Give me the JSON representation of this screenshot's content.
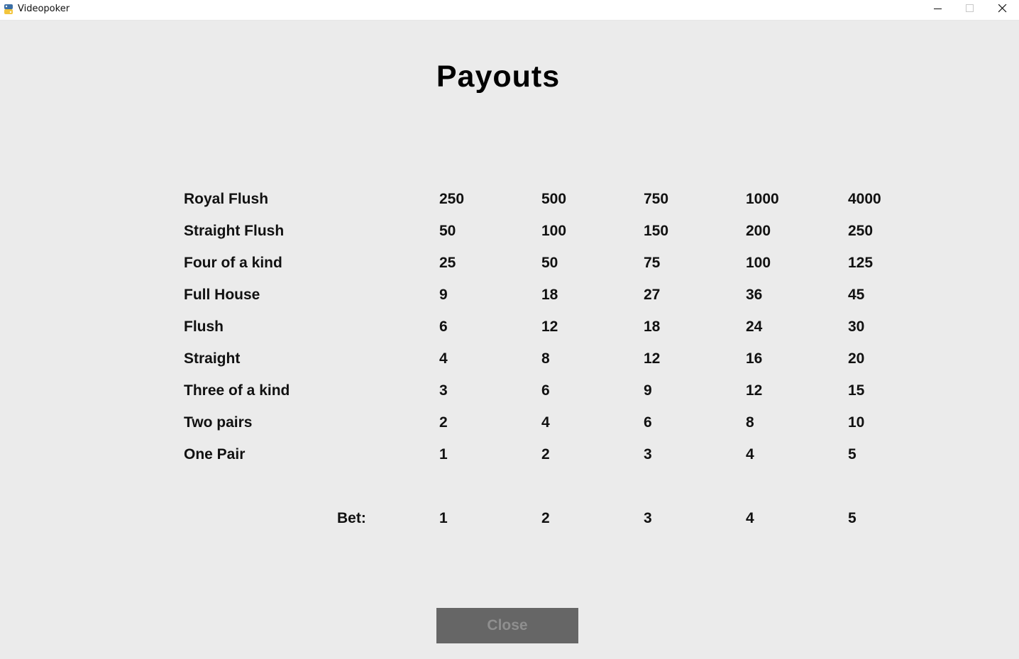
{
  "window": {
    "title": "Videopoker",
    "icon": "python-icon"
  },
  "page": {
    "title": "Payouts"
  },
  "paytable": {
    "rows": [
      {
        "label": "Royal Flush",
        "values": [
          "250",
          "500",
          "750",
          "1000",
          "4000"
        ]
      },
      {
        "label": "Straight Flush",
        "values": [
          "50",
          "100",
          "150",
          "200",
          "250"
        ]
      },
      {
        "label": "Four of a kind",
        "values": [
          "25",
          "50",
          "75",
          "100",
          "125"
        ]
      },
      {
        "label": "Full House",
        "values": [
          "9",
          "18",
          "27",
          "36",
          "45"
        ]
      },
      {
        "label": "Flush",
        "values": [
          "6",
          "12",
          "18",
          "24",
          "30"
        ]
      },
      {
        "label": "Straight",
        "values": [
          "4",
          "8",
          "12",
          "16",
          "20"
        ]
      },
      {
        "label": "Three of a kind",
        "values": [
          "3",
          "6",
          "9",
          "12",
          "15"
        ]
      },
      {
        "label": "Two pairs",
        "values": [
          "2",
          "4",
          "6",
          "8",
          "10"
        ]
      },
      {
        "label": "One Pair",
        "values": [
          "1",
          "2",
          "3",
          "4",
          "5"
        ]
      }
    ],
    "bet_label": "Bet:",
    "bets": [
      "1",
      "2",
      "3",
      "4",
      "5"
    ]
  },
  "close_button": {
    "label": "Close"
  },
  "colors": {
    "background": "#ebebeb",
    "button_bg": "#666666",
    "button_text": "#8f8f8f"
  }
}
